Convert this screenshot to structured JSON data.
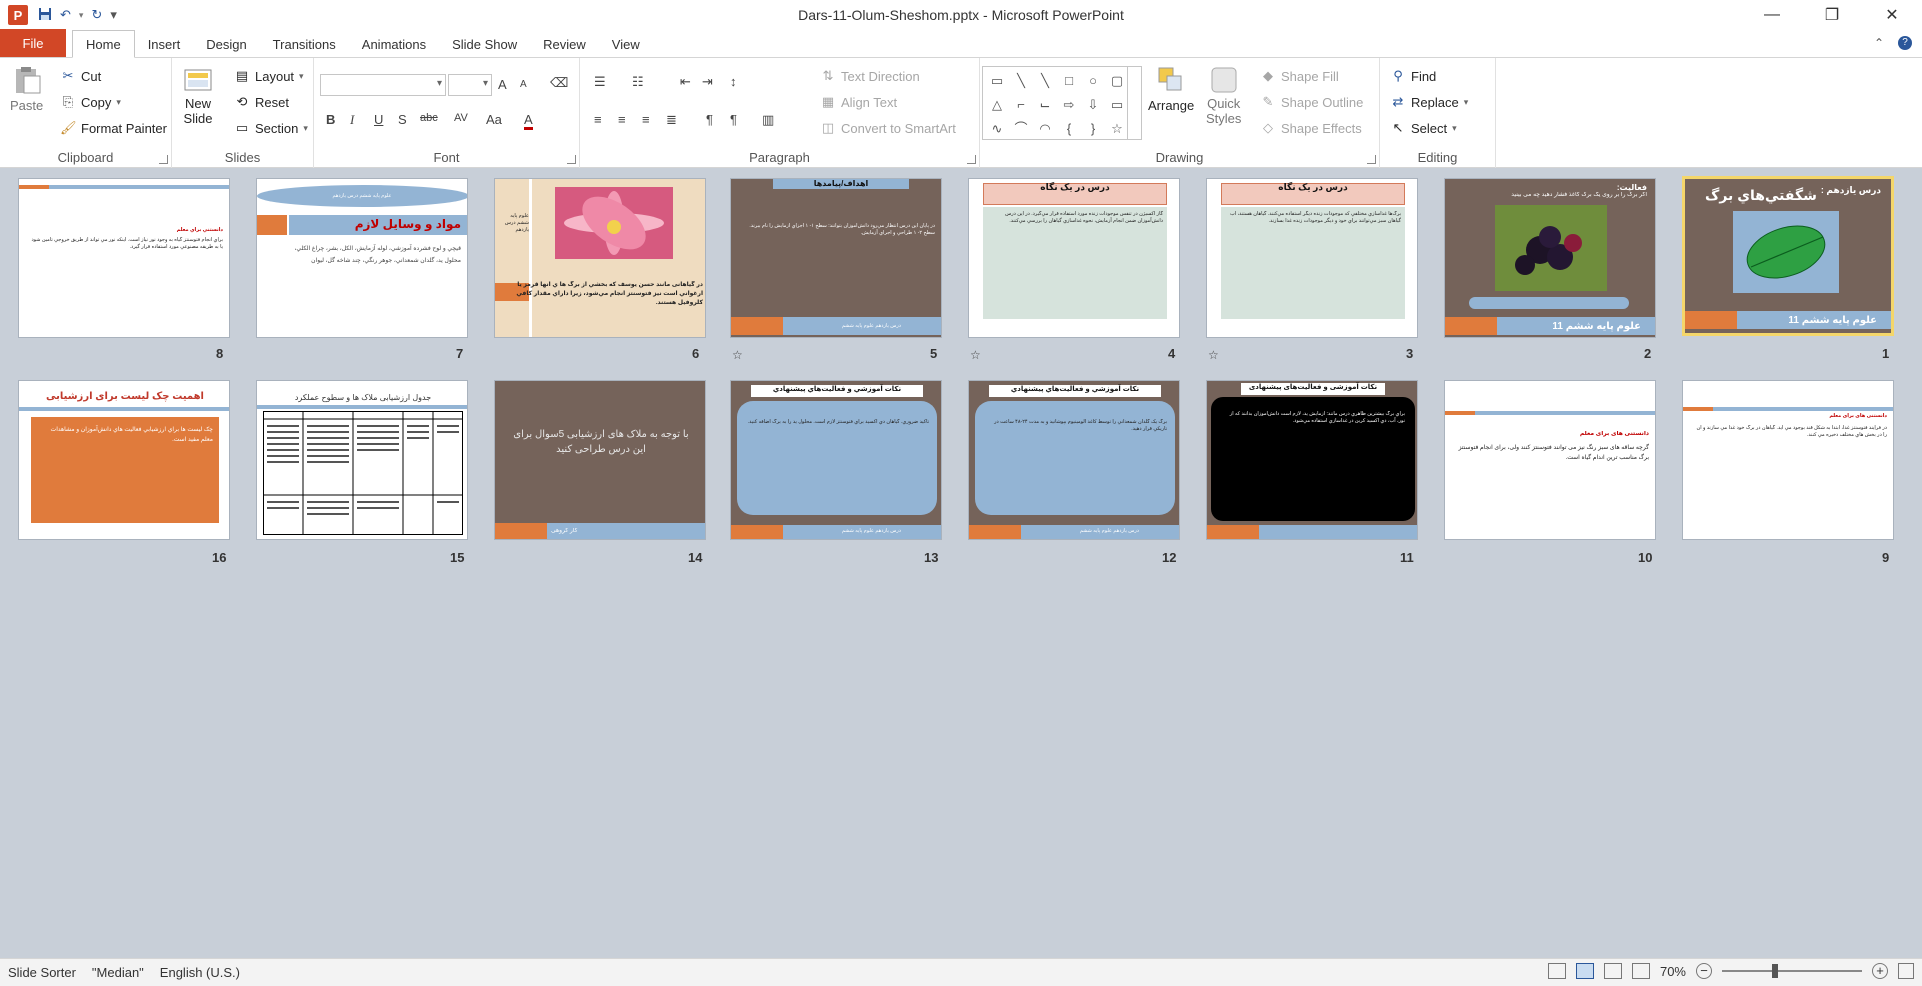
{
  "window": {
    "title": "Dars-11-Olum-Sheshom.pptx - Microsoft PowerPoint",
    "app_letter": "P",
    "controls": [
      "—",
      "❐",
      "✕"
    ]
  },
  "qat": {
    "save": "save-icon",
    "undo": "undo-icon",
    "redo": "redo-icon",
    "customize": "▾"
  },
  "tabs": [
    {
      "label": "File"
    },
    {
      "label": "Home"
    },
    {
      "label": "Insert"
    },
    {
      "label": "Design"
    },
    {
      "label": "Transitions"
    },
    {
      "label": "Animations"
    },
    {
      "label": "Slide Show"
    },
    {
      "label": "Review"
    },
    {
      "label": "View"
    }
  ],
  "ribbon": {
    "clipboard": {
      "label": "Clipboard",
      "paste": "Paste",
      "cut": "Cut",
      "copy": "Copy",
      "format_painter": "Format Painter"
    },
    "slides": {
      "label": "Slides",
      "new_slide_1": "New",
      "new_slide_2": "Slide",
      "layout": "Layout",
      "reset": "Reset",
      "section": "Section"
    },
    "font": {
      "label": "Font",
      "bold": "B",
      "italic": "I",
      "underline": "U",
      "shadow": "S",
      "strike": "abc",
      "spacing": "AV",
      "case": "Aa",
      "color": "A",
      "grow": "A",
      "shrink": "A"
    },
    "paragraph": {
      "label": "Paragraph",
      "text_direction": "Text Direction",
      "align_text": "Align Text",
      "convert_smartart": "Convert to SmartArt"
    },
    "drawing": {
      "label": "Drawing",
      "arrange": "Arrange",
      "quick_styles_1": "Quick",
      "quick_styles_2": "Styles",
      "shape_fill": "Shape Fill",
      "shape_outline": "Shape Outline",
      "shape_effects": "Shape Effects"
    },
    "editing": {
      "label": "Editing",
      "find": "Find",
      "replace": "Replace",
      "select": "Select"
    }
  },
  "slides": [
    {
      "n": "1",
      "title": "شگفتي‌هاي برگ",
      "subtitle": "درس يازدهم :",
      "footer": "علوم پايه ششم     11"
    },
    {
      "n": "2",
      "title": "فعاليت:",
      "subtitle": "اگر برگ را بر روی یک برگ کاغذ فشار دهید چه می بینید",
      "footer": "علوم پايه ششم     11"
    },
    {
      "n": "3",
      "title": "درس در یک نگاه",
      "body": "برگ‌ها غذاسازي مختلفي که موجودات زنده ديگر استفاده مي‌کنند. گياهان هستند، آب گياهان سبز مي‌توانند براي خود و ديگر موجودات زنده غذا بسازند."
    },
    {
      "n": "4",
      "title": "درس در یک نگاه",
      "body": "گاز اکسيژن در تنفس موجودات زنده مورد استفاده قرار مي‌گيرد. در اين درس دانش‌آموزان ضمن انجام آزمايش، نحوه غذاسازي گياهان را بررسي مي‌کنند."
    },
    {
      "n": "5",
      "title": "اهداف/پیامدها",
      "body": "در پايان اين درس انتظار مي‌رود دانش‌آموزان بتوانند: سطح ۱- ۱ اجزاي آزمايش را نام ببرند. سطح ۲- ۱ طراحي و اجراي آزمايش.",
      "footer": "درس يازدهم  علوم پايه ششم"
    },
    {
      "n": "6",
      "title": "علوم پايه ششم درس يازدهم",
      "body": "در گیاهانی مانند حسن يوسف که بخشي از برگ ها ي آنها قرمز يا ارغواني است نيز فتوسنتز انجام مي‌شود، زيرا داراي مقدار کافي کلروفيل هستند."
    },
    {
      "n": "7",
      "title": "مواد و وسایل لازم",
      "subtitle": "علوم پايه ششم درس يازدهم",
      "body": "قيچي و لوح فشرده آموزشي، لوله آزمايش، الکل، بشر، چراغ الکلي، محلول يد، گلدان شمعداني، جوهر رنگي، چند شاخه گل، ليوان"
    },
    {
      "n": "8",
      "title": "دانستني براي معلم",
      "body": "براي انجام فتوسنتز گياه به وجود نور نياز است. اينكه نور مي تواند از طريق خروجي تامين شود يا به طريقه مصنوعي مورد استفاده قرار گيرد."
    },
    {
      "n": "9",
      "title": "دانستنی های برای معلم",
      "body": "در فرايند فتوسنتز غذا، ابتدا به شکل قند بوجود مي آيد. گياهان در برگ خود غذا مي سازند و آن را در بخش هاي مختلف ذخيره مي کنند."
    },
    {
      "n": "10",
      "title": "دانستنی های برای معلم",
      "body": "گرچه ساقه های سبز رنگ نیز می توانند فتوسنتز کنند ولی، برای انجام فتوسنتز برگ مناسب ترين اندام گياه است."
    },
    {
      "n": "11",
      "title": "نکات آموزشی و فعالیت‌های پیشنهادی",
      "body": "براي برگ بيشترين ظاهري درس مانند: آزمايش يد، لازم است دانش‌آموزان بدانند که از نور، آب، دي اکسيد کربن در غذاسازي استفاده مي‌شود."
    },
    {
      "n": "12",
      "title": "نکات آموزشي و فعاليت‌هاي پيشنهادي",
      "body": "برگ يک گلدان شمعداني را توسط کاغذ آلومينيوم بپوشانيد و به مدت ۲۴-۴۸ ساعت در تاريکي قرار دهيد.",
      "footer": "درس يازدهم  علوم پايه ششم"
    },
    {
      "n": "13",
      "title": "نکات آموزشي و فعاليت‌هاي پيشنهادي",
      "body": "تاکيد ضروري. گياهان دي اکسيد براي فتوسنتز لازم است. محلول يد را به برگ اضافه کنيد.",
      "footer": "درس يازدهم  علوم پايه ششم"
    },
    {
      "n": "14",
      "title": "با توجه به ملاک های ارزشیابی 5سوال برای این درس طراحی کنید",
      "footer": "کار گروهی"
    },
    {
      "n": "15",
      "title": "جدول ارزشیابی ملاک ها و سطوح عملکرد"
    },
    {
      "n": "16",
      "title": "اهمیت چک لیست برای ارزشیابی",
      "body": "چک ليست ها براي ارزشيابي فعاليت هاي دانش‌آموزان و مشاهدات معلم مفيد است."
    }
  ],
  "status": {
    "view": "Slide Sorter",
    "theme": "\"Median\"",
    "language": "English (U.S.)",
    "zoom": "70%",
    "zoom_fraction": 0.37
  },
  "colors": {
    "file_tab": "#d24726",
    "brown": "#75635a",
    "blue_band": "#93b4d4",
    "orange": "#e07b3c",
    "selected_border": "#f4d66a",
    "sorter_bg": "#c8cfd8"
  }
}
